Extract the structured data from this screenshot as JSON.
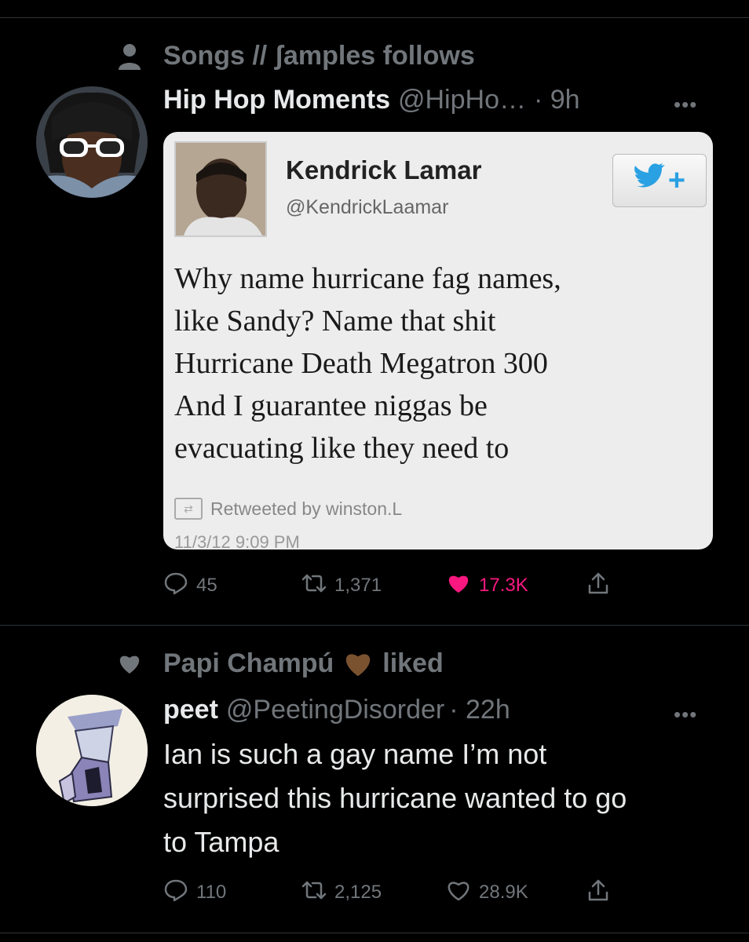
{
  "tweet1": {
    "context_text": "Songs // ʃamples follows",
    "author_name": "Hip Hop Moments",
    "author_handle": "@HipHo…",
    "time": "· 9h",
    "more": "•••",
    "embedded": {
      "name": "Kendrick Lamar",
      "handle": "@KendrickLaamar",
      "follow_label": "+",
      "text_lines": [
        "Why name hurricane fag names,",
        "like Sandy? Name that shit",
        "Hurricane Death Megatron 300",
        "And I guarantee niggas be",
        "evacuating like they need to"
      ],
      "retweet_text": "Retweeted by winston.L",
      "date": "11/3/12 9:09 PM"
    },
    "stats": {
      "replies": "45",
      "retweets": "1,371",
      "likes": "17.3K",
      "liked": true
    }
  },
  "tweet2": {
    "context_name": "Papi Champú",
    "context_suffix": "liked",
    "author_name": "peet",
    "author_handle": "@PeetingDisorder",
    "time": "· 22h",
    "more": "•••",
    "text_lines": [
      "Ian is such a gay name I’m not",
      "surprised this hurricane wanted to go",
      "to Tampa"
    ],
    "stats": {
      "replies": "110",
      "retweets": "2,125",
      "likes": "28.9K",
      "liked": false
    }
  },
  "colors": {
    "like_active": "#f91880",
    "muted": "#71767b",
    "brown_heart": "#7a5230",
    "twitter_blue": "#2aa1e3"
  }
}
